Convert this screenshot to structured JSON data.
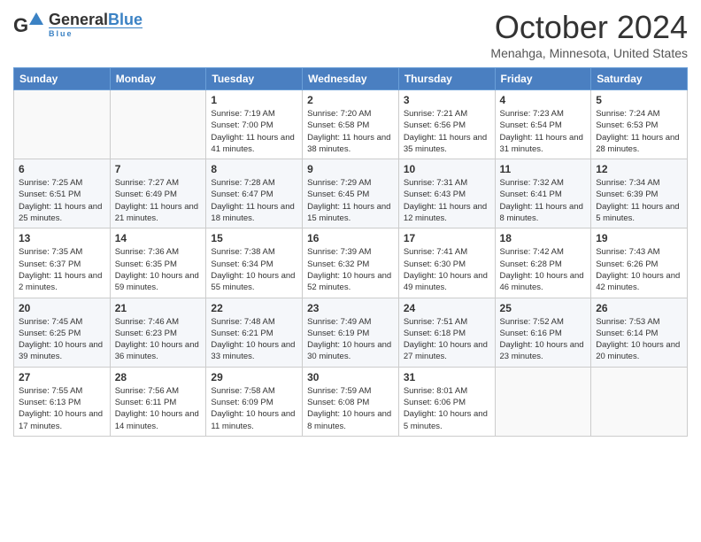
{
  "header": {
    "logo_general": "General",
    "logo_blue": "Blue",
    "main_title": "October 2024",
    "subtitle": "Menahga, Minnesota, United States"
  },
  "weekdays": [
    "Sunday",
    "Monday",
    "Tuesday",
    "Wednesday",
    "Thursday",
    "Friday",
    "Saturday"
  ],
  "weeks": [
    [
      {
        "day": "",
        "sunrise": "",
        "sunset": "",
        "daylight": ""
      },
      {
        "day": "",
        "sunrise": "",
        "sunset": "",
        "daylight": ""
      },
      {
        "day": "1",
        "sunrise": "Sunrise: 7:19 AM",
        "sunset": "Sunset: 7:00 PM",
        "daylight": "Daylight: 11 hours and 41 minutes."
      },
      {
        "day": "2",
        "sunrise": "Sunrise: 7:20 AM",
        "sunset": "Sunset: 6:58 PM",
        "daylight": "Daylight: 11 hours and 38 minutes."
      },
      {
        "day": "3",
        "sunrise": "Sunrise: 7:21 AM",
        "sunset": "Sunset: 6:56 PM",
        "daylight": "Daylight: 11 hours and 35 minutes."
      },
      {
        "day": "4",
        "sunrise": "Sunrise: 7:23 AM",
        "sunset": "Sunset: 6:54 PM",
        "daylight": "Daylight: 11 hours and 31 minutes."
      },
      {
        "day": "5",
        "sunrise": "Sunrise: 7:24 AM",
        "sunset": "Sunset: 6:53 PM",
        "daylight": "Daylight: 11 hours and 28 minutes."
      }
    ],
    [
      {
        "day": "6",
        "sunrise": "Sunrise: 7:25 AM",
        "sunset": "Sunset: 6:51 PM",
        "daylight": "Daylight: 11 hours and 25 minutes."
      },
      {
        "day": "7",
        "sunrise": "Sunrise: 7:27 AM",
        "sunset": "Sunset: 6:49 PM",
        "daylight": "Daylight: 11 hours and 21 minutes."
      },
      {
        "day": "8",
        "sunrise": "Sunrise: 7:28 AM",
        "sunset": "Sunset: 6:47 PM",
        "daylight": "Daylight: 11 hours and 18 minutes."
      },
      {
        "day": "9",
        "sunrise": "Sunrise: 7:29 AM",
        "sunset": "Sunset: 6:45 PM",
        "daylight": "Daylight: 11 hours and 15 minutes."
      },
      {
        "day": "10",
        "sunrise": "Sunrise: 7:31 AM",
        "sunset": "Sunset: 6:43 PM",
        "daylight": "Daylight: 11 hours and 12 minutes."
      },
      {
        "day": "11",
        "sunrise": "Sunrise: 7:32 AM",
        "sunset": "Sunset: 6:41 PM",
        "daylight": "Daylight: 11 hours and 8 minutes."
      },
      {
        "day": "12",
        "sunrise": "Sunrise: 7:34 AM",
        "sunset": "Sunset: 6:39 PM",
        "daylight": "Daylight: 11 hours and 5 minutes."
      }
    ],
    [
      {
        "day": "13",
        "sunrise": "Sunrise: 7:35 AM",
        "sunset": "Sunset: 6:37 PM",
        "daylight": "Daylight: 11 hours and 2 minutes."
      },
      {
        "day": "14",
        "sunrise": "Sunrise: 7:36 AM",
        "sunset": "Sunset: 6:35 PM",
        "daylight": "Daylight: 10 hours and 59 minutes."
      },
      {
        "day": "15",
        "sunrise": "Sunrise: 7:38 AM",
        "sunset": "Sunset: 6:34 PM",
        "daylight": "Daylight: 10 hours and 55 minutes."
      },
      {
        "day": "16",
        "sunrise": "Sunrise: 7:39 AM",
        "sunset": "Sunset: 6:32 PM",
        "daylight": "Daylight: 10 hours and 52 minutes."
      },
      {
        "day": "17",
        "sunrise": "Sunrise: 7:41 AM",
        "sunset": "Sunset: 6:30 PM",
        "daylight": "Daylight: 10 hours and 49 minutes."
      },
      {
        "day": "18",
        "sunrise": "Sunrise: 7:42 AM",
        "sunset": "Sunset: 6:28 PM",
        "daylight": "Daylight: 10 hours and 46 minutes."
      },
      {
        "day": "19",
        "sunrise": "Sunrise: 7:43 AM",
        "sunset": "Sunset: 6:26 PM",
        "daylight": "Daylight: 10 hours and 42 minutes."
      }
    ],
    [
      {
        "day": "20",
        "sunrise": "Sunrise: 7:45 AM",
        "sunset": "Sunset: 6:25 PM",
        "daylight": "Daylight: 10 hours and 39 minutes."
      },
      {
        "day": "21",
        "sunrise": "Sunrise: 7:46 AM",
        "sunset": "Sunset: 6:23 PM",
        "daylight": "Daylight: 10 hours and 36 minutes."
      },
      {
        "day": "22",
        "sunrise": "Sunrise: 7:48 AM",
        "sunset": "Sunset: 6:21 PM",
        "daylight": "Daylight: 10 hours and 33 minutes."
      },
      {
        "day": "23",
        "sunrise": "Sunrise: 7:49 AM",
        "sunset": "Sunset: 6:19 PM",
        "daylight": "Daylight: 10 hours and 30 minutes."
      },
      {
        "day": "24",
        "sunrise": "Sunrise: 7:51 AM",
        "sunset": "Sunset: 6:18 PM",
        "daylight": "Daylight: 10 hours and 27 minutes."
      },
      {
        "day": "25",
        "sunrise": "Sunrise: 7:52 AM",
        "sunset": "Sunset: 6:16 PM",
        "daylight": "Daylight: 10 hours and 23 minutes."
      },
      {
        "day": "26",
        "sunrise": "Sunrise: 7:53 AM",
        "sunset": "Sunset: 6:14 PM",
        "daylight": "Daylight: 10 hours and 20 minutes."
      }
    ],
    [
      {
        "day": "27",
        "sunrise": "Sunrise: 7:55 AM",
        "sunset": "Sunset: 6:13 PM",
        "daylight": "Daylight: 10 hours and 17 minutes."
      },
      {
        "day": "28",
        "sunrise": "Sunrise: 7:56 AM",
        "sunset": "Sunset: 6:11 PM",
        "daylight": "Daylight: 10 hours and 14 minutes."
      },
      {
        "day": "29",
        "sunrise": "Sunrise: 7:58 AM",
        "sunset": "Sunset: 6:09 PM",
        "daylight": "Daylight: 10 hours and 11 minutes."
      },
      {
        "day": "30",
        "sunrise": "Sunrise: 7:59 AM",
        "sunset": "Sunset: 6:08 PM",
        "daylight": "Daylight: 10 hours and 8 minutes."
      },
      {
        "day": "31",
        "sunrise": "Sunrise: 8:01 AM",
        "sunset": "Sunset: 6:06 PM",
        "daylight": "Daylight: 10 hours and 5 minutes."
      },
      {
        "day": "",
        "sunrise": "",
        "sunset": "",
        "daylight": ""
      },
      {
        "day": "",
        "sunrise": "",
        "sunset": "",
        "daylight": ""
      }
    ]
  ]
}
